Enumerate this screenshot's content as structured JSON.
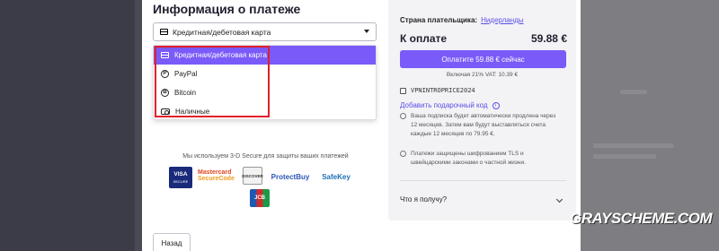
{
  "payment": {
    "title": "Информация о платеже",
    "method_selected": "Кредитная/дебетовая карта",
    "options": [
      {
        "label": "Кредитная/дебетовая карта",
        "icon": "card-icon"
      },
      {
        "label": "PayPal",
        "icon": "paypal-icon"
      },
      {
        "label": "Bitcoin",
        "icon": "bitcoin-icon"
      },
      {
        "label": "Наличные",
        "icon": "cash-icon"
      }
    ],
    "secure_note": "Мы используем 3-D Secure для защиты ваших платежей",
    "badges": {
      "visa": "VISA",
      "visa_sub": "SECURE",
      "mastercard": "Mastercard",
      "securecode": "SecureCode",
      "discover": "DISCOVER",
      "protectbuy": "ProtectBuy",
      "safekey": "SafeKey",
      "jcb": "JCB"
    },
    "back_label": "Назад"
  },
  "summary": {
    "country_label": "Страна плательщика:",
    "country_value": "Нидерланды",
    "total_label": "К оплате",
    "total_value": "59.88 €",
    "pay_button": "Оплатите 59.88 € сейчас",
    "vat": "Включая 21% VAT: 10.39 €",
    "coupon": "VPNINTROPRICE2024",
    "gift_link": "Добавить подарочный код",
    "note_renewal": "Ваша подписка будет автоматически продлена через 12 месяцев. Затем вам будут выставляться счета каждые 12 месяцев по 79.95 €.",
    "note_security": "Платежи защищены шифрованием TLS и швейцарскими законами о частной жизни.",
    "faq": "Что я получу?"
  },
  "watermark": "GRAYSCHEME.COM",
  "colors": {
    "accent": "#7a5af8",
    "highlight": "#e0202a",
    "link": "#5b4ee8"
  }
}
